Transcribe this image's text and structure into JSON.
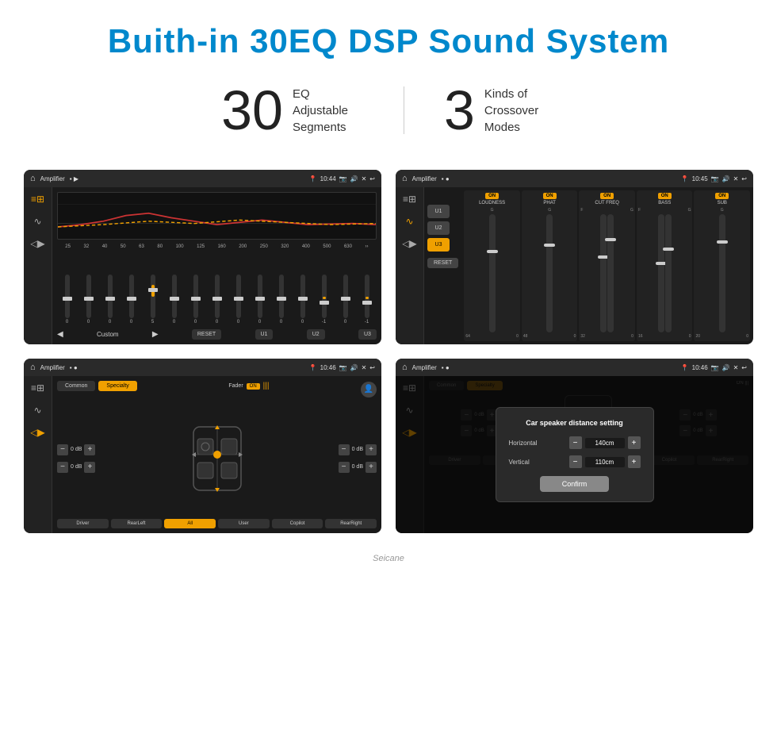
{
  "page": {
    "title": "Buith-in 30EQ DSP Sound System",
    "stat1_number": "30",
    "stat1_desc_line1": "EQ Adjustable",
    "stat1_desc_line2": "Segments",
    "stat2_number": "3",
    "stat2_desc_line1": "Kinds of",
    "stat2_desc_line2": "Crossover Modes"
  },
  "screen1": {
    "title": "Amplifier",
    "time": "10:44",
    "freqs": [
      "25",
      "32",
      "40",
      "50",
      "63",
      "80",
      "100",
      "125",
      "160",
      "200",
      "250",
      "320",
      "400",
      "500",
      "630"
    ],
    "values": [
      "0",
      "0",
      "0",
      "0",
      "5",
      "0",
      "0",
      "0",
      "0",
      "0",
      "0",
      "0",
      "-1",
      "0",
      "-1"
    ],
    "buttons": [
      "RESET",
      "U1",
      "U2",
      "U3"
    ],
    "preset_label": "Custom"
  },
  "screen2": {
    "title": "Amplifier",
    "time": "10:45",
    "u_buttons": [
      "U1",
      "U2",
      "U3"
    ],
    "bands": [
      "LOUDNESS",
      "PHAT",
      "CUT FREQ",
      "BASS",
      "SUB"
    ],
    "reset_label": "RESET"
  },
  "screen3": {
    "title": "Amplifier",
    "time": "10:46",
    "tabs": [
      "Common",
      "Specialty"
    ],
    "fader_label": "Fader",
    "fader_state": "ON",
    "db_values": [
      "0 dB",
      "0 dB",
      "0 dB",
      "0 dB"
    ],
    "buttons": [
      "Driver",
      "RearLeft",
      "All",
      "User",
      "Copilot",
      "RearRight"
    ]
  },
  "screen4": {
    "title": "Amplifier",
    "time": "10:46",
    "tabs": [
      "Common",
      "Specialty"
    ],
    "dialog": {
      "title": "Car speaker distance setting",
      "horizontal_label": "Horizontal",
      "horizontal_value": "140cm",
      "vertical_label": "Vertical",
      "vertical_value": "110cm",
      "confirm_label": "Confirm"
    },
    "buttons": [
      "Driver",
      "RearLeft",
      "All",
      "User",
      "Copilot",
      "RearRight"
    ]
  },
  "watermark": "Seicane"
}
